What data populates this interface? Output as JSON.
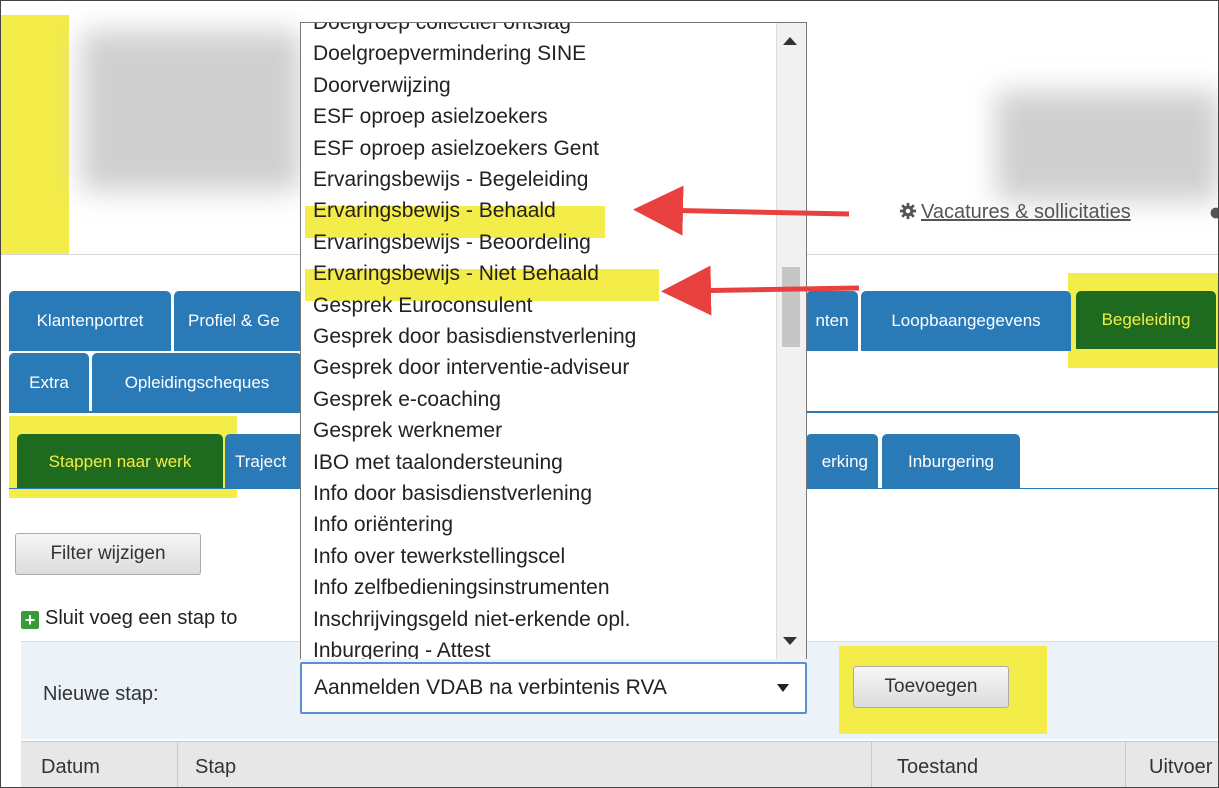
{
  "header": {
    "link_vacatures": "Vacatures & sollicitaties"
  },
  "tabs_row1": [
    "Klantenportret",
    "Profiel & Ge",
    "nten",
    "Loopbaangegevens",
    "Begeleiding"
  ],
  "tabs_row2": [
    "Extra",
    "Opleidingscheques"
  ],
  "tabs_row3": [
    "Stappen naar werk",
    "Traject",
    "erking",
    "Inburgering"
  ],
  "filter_button": "Filter wijzigen",
  "add_link": "Sluit voeg een stap to",
  "dropdown_list": [
    "Doelgroep collectief ontslag",
    "Doelgroepvermindering SINE",
    "Doorverwijzing",
    "ESF oproep asielzoekers",
    "ESF oproep asielzoekers Gent",
    "Ervaringsbewijs - Begeleiding",
    "Ervaringsbewijs - Behaald",
    "Ervaringsbewijs - Beoordeling",
    "Ervaringsbewijs - Niet Behaald",
    "Gesprek Euroconsulent",
    "Gesprek door basisdienstverlening",
    "Gesprek door interventie-adviseur",
    "Gesprek e-coaching",
    "Gesprek werknemer",
    "IBO met taalondersteuning",
    "Info door basisdienstverlening",
    "Info oriëntering",
    "Info over tewerkstellingscel",
    "Info zelfbedieningsinstrumenten",
    "Inschrijvingsgeld niet-erkende opl.",
    "Inburgering - Attest"
  ],
  "form": {
    "new_step_label": "Nieuwe stap:",
    "selected_value": "Aanmelden VDAB na verbintenis RVA",
    "add_button": "Toevoegen"
  },
  "table_headers": [
    "Datum",
    "Stap",
    "Toestand",
    "Uitvoer"
  ],
  "colors": {
    "highlight": "#f4ec48",
    "tab_blue": "#2a7ab8",
    "tab_active": "#1e6b20",
    "arrow_red": "#e8403f"
  }
}
